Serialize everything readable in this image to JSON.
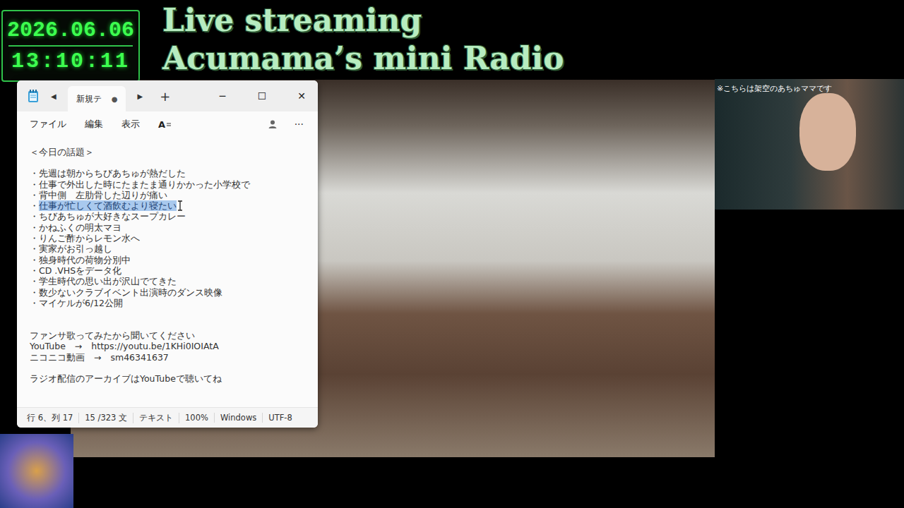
{
  "clock": {
    "date": "2026.06.06",
    "time": "13:10:11"
  },
  "stream_title": {
    "line1": "Live streaming",
    "line2": "Acumama’s mini Radio"
  },
  "portrait": {
    "caption": "※こちらは架空のあちゅママです"
  },
  "notepad": {
    "nav_back": "◀",
    "nav_forward": "▶",
    "tab": {
      "label": "新規テ",
      "modified_mark": "●",
      "selected": true
    },
    "new_tab": "+",
    "controls": [
      "─",
      "☐",
      "✕"
    ],
    "menu": [
      "ファイル",
      "編集",
      "表示"
    ],
    "font_button": "A",
    "more": "···",
    "heading": "＜今日の話題＞",
    "topics": [
      {
        "bullet": "・",
        "text": "先週は朝からちびあちゅが熱だした",
        "selected": false
      },
      {
        "bullet": "・",
        "text": "仕事で外出した時にたまたま通りかかった小学校で",
        "selected": false
      },
      {
        "bullet": "・",
        "text": "背中側　左肋骨した辺りが痛い",
        "selected": false
      },
      {
        "bullet": "・",
        "text": "仕事が忙しくて酒飲むより寝たい",
        "selected": true
      },
      {
        "bullet": "・",
        "text": "ちびあちゅが大好きなスープカレー",
        "selected": false
      },
      {
        "bullet": "・",
        "text": "かねふくの明太マヨ",
        "selected": false
      },
      {
        "bullet": "・",
        "text": "りんご酢からレモン水へ",
        "selected": false
      },
      {
        "bullet": "・",
        "text": "実家がお引っ越し",
        "selected": false
      },
      {
        "bullet": "・",
        "text": "独身時代の荷物分別中",
        "selected": false
      },
      {
        "bullet": "・",
        "text": "CD .VHSをデータ化",
        "selected": false
      },
      {
        "bullet": "・",
        "text": "学生時代の思い出が沢山でてきた",
        "selected": false
      },
      {
        "bullet": "・",
        "text": "数少ないクラブイベント出演時のダンス映像",
        "selected": false
      },
      {
        "bullet": "・",
        "text": "マイケルが6/12公開",
        "selected": false
      }
    ],
    "footer_lines": [
      "ファンサ歌ってみたから聞いてください",
      "YouTube　→　https://youtu.be/1KHi0IOIAtA",
      "ニコニコ動画　→　sm46341637"
    ],
    "archive_note": "ラジオ配信のアーカイブはYouTubeで聴いてね",
    "status": [
      "行 6、列 17",
      "15 /323 文",
      "テキスト",
      "100%",
      "Windows",
      "UTF-8"
    ]
  }
}
